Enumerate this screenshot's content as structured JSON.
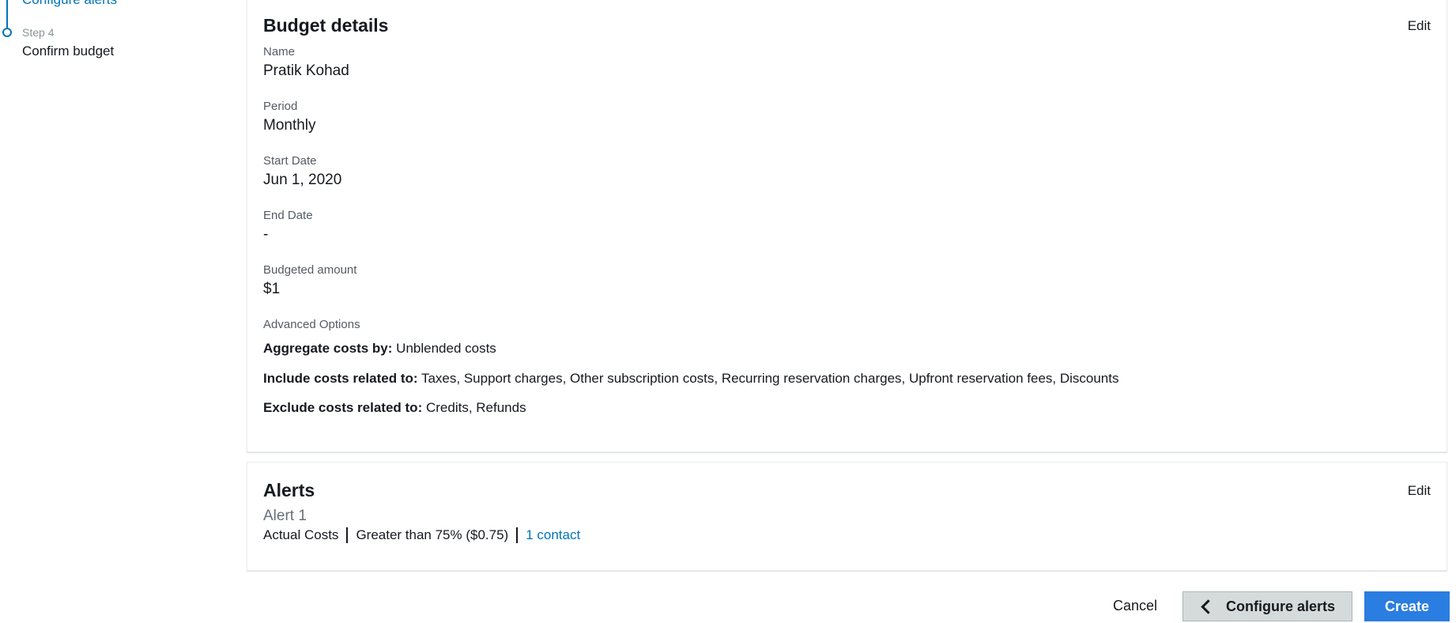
{
  "sidebar": {
    "prev_step_label": "Configure alerts",
    "current_step_number": "Step 4",
    "current_step_title": "Confirm budget"
  },
  "budget_details": {
    "title": "Budget details",
    "edit_label": "Edit",
    "fields": [
      {
        "label": "Name",
        "value": "Pratik Kohad"
      },
      {
        "label": "Period",
        "value": "Monthly"
      },
      {
        "label": "Start Date",
        "value": "Jun 1, 2020"
      },
      {
        "label": "End Date",
        "value": "-"
      },
      {
        "label": "Budgeted amount",
        "value": "$1"
      }
    ],
    "advanced": {
      "label": "Advanced Options",
      "aggregate_key": "Aggregate costs by:",
      "aggregate_value": "Unblended costs",
      "include_key": "Include costs related to:",
      "include_value": "Taxes, Support charges, Other subscription costs, Recurring reservation charges, Upfront reservation fees, Discounts",
      "exclude_key": "Exclude costs related to:",
      "exclude_value": "Credits, Refunds"
    }
  },
  "alerts": {
    "title": "Alerts",
    "edit_label": "Edit",
    "items": [
      {
        "name": "Alert 1",
        "cost_type": "Actual Costs",
        "threshold": "Greater than 75% ($0.75)",
        "contacts": "1 contact"
      }
    ]
  },
  "footer": {
    "cancel_label": "Cancel",
    "previous_label": "Configure alerts",
    "create_label": "Create"
  },
  "colors": {
    "link": "#0073bb",
    "primary_button": "#2a7de1",
    "secondary_button": "#d5dbdb"
  }
}
